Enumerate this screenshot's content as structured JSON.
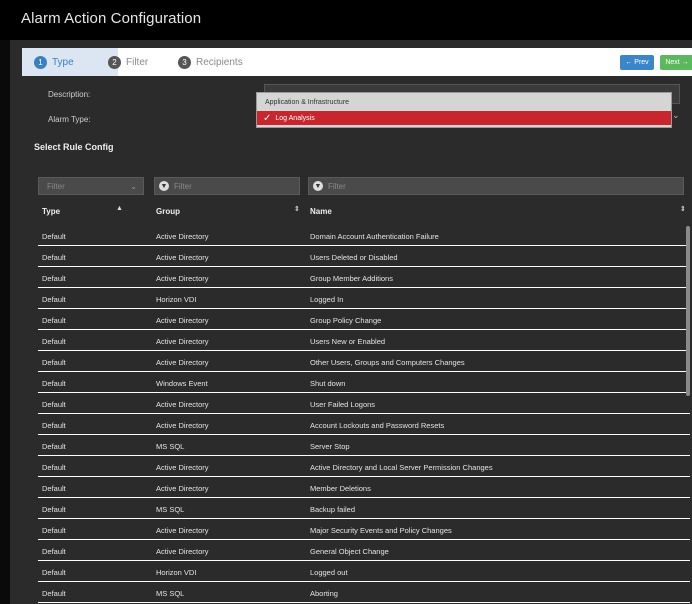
{
  "window": {
    "title": "Alarm Action Configuration"
  },
  "wizard": {
    "steps": [
      {
        "num": "1",
        "label": "Type"
      },
      {
        "num": "2",
        "label": "Filter"
      },
      {
        "num": "3",
        "label": "Recipients"
      }
    ],
    "prev_label": "← Prev",
    "next_label": "Next →"
  },
  "form": {
    "description_label": "Description:",
    "alarm_type_label": "Alarm Type:",
    "alarm_type_options": [
      "Application & Infrastructure",
      "Log Analysis"
    ],
    "selected_option": "Log Analysis"
  },
  "section": {
    "title": "Select Rule Config"
  },
  "filters": {
    "type_placeholder": "Filter",
    "group_placeholder": "Filter",
    "name_placeholder": "Filter"
  },
  "table": {
    "headers": [
      "Type",
      "Group",
      "Name"
    ],
    "rows": [
      [
        "Default",
        "Active Directory",
        "Domain Account Authentication Failure"
      ],
      [
        "Default",
        "Active Directory",
        "Users Deleted or Disabled"
      ],
      [
        "Default",
        "Active Directory",
        "Group Member Additions"
      ],
      [
        "Default",
        "Horizon VDI",
        "Logged In"
      ],
      [
        "Default",
        "Active Directory",
        "Group Policy Change"
      ],
      [
        "Default",
        "Active Directory",
        "Users New or Enabled"
      ],
      [
        "Default",
        "Active Directory",
        "Other Users, Groups and Computers Changes"
      ],
      [
        "Default",
        "Windows Event",
        "Shut down"
      ],
      [
        "Default",
        "Active Directory",
        "User Failed Logons"
      ],
      [
        "Default",
        "Active Directory",
        "Account Lockouts and Password Resets"
      ],
      [
        "Default",
        "MS SQL",
        "Server Stop"
      ],
      [
        "Default",
        "Active Directory",
        "Active Directory and Local Server Permission Changes"
      ],
      [
        "Default",
        "Active Directory",
        "Member Deletions"
      ],
      [
        "Default",
        "MS SQL",
        "Backup failed"
      ],
      [
        "Default",
        "Active Directory",
        "Major Security Events and Policy Changes"
      ],
      [
        "Default",
        "Active Directory",
        "General Object Change"
      ],
      [
        "Default",
        "Horizon VDI",
        "Logged out"
      ],
      [
        "Default",
        "MS SQL",
        "Aborting"
      ]
    ]
  },
  "colors": {
    "accent": "#3a7fc1",
    "selected": "#c9252c",
    "next": "#5cb85c"
  }
}
